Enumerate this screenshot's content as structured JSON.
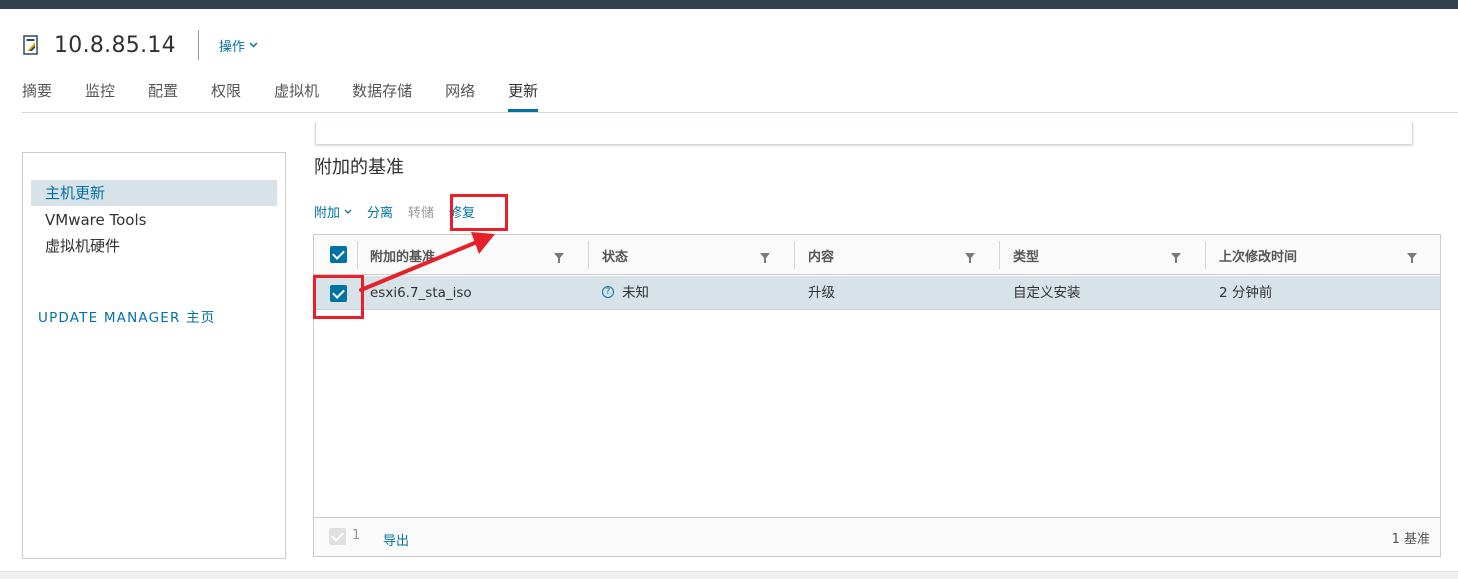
{
  "header": {
    "host_name": "10.8.85.14",
    "actions_label": "操作"
  },
  "tabs": [
    {
      "label": "摘要"
    },
    {
      "label": "监控"
    },
    {
      "label": "配置"
    },
    {
      "label": "权限"
    },
    {
      "label": "虚拟机"
    },
    {
      "label": "数据存储"
    },
    {
      "label": "网络"
    },
    {
      "label": "更新",
      "active": true
    }
  ],
  "sidebar": {
    "items": [
      {
        "label": "主机更新",
        "active": true
      },
      {
        "label": "VMware Tools"
      },
      {
        "label": "虚拟机硬件"
      }
    ],
    "update_manager_link": "UPDATE MANAGER 主页"
  },
  "section": {
    "title": "附加的基准"
  },
  "toolbar": {
    "attach": "附加",
    "detach": "分离",
    "stage": "转储",
    "remediate": "修复"
  },
  "grid": {
    "columns": [
      "附加的基准",
      "状态",
      "内容",
      "类型",
      "上次修改时间"
    ],
    "rows": [
      {
        "baseline": "esxi6.7_sta_iso",
        "status": "未知",
        "content": "升级",
        "type": "自定义安装",
        "modified": "2 分钟前"
      }
    ],
    "footer": {
      "selected_count": "1",
      "export_label": "导出",
      "total_label": "1 基准"
    }
  },
  "colors": {
    "accent": "#0072a3",
    "topbar": "#313f4e",
    "selected_row": "#d8e3e9",
    "annotation_red": "#e8202a"
  }
}
